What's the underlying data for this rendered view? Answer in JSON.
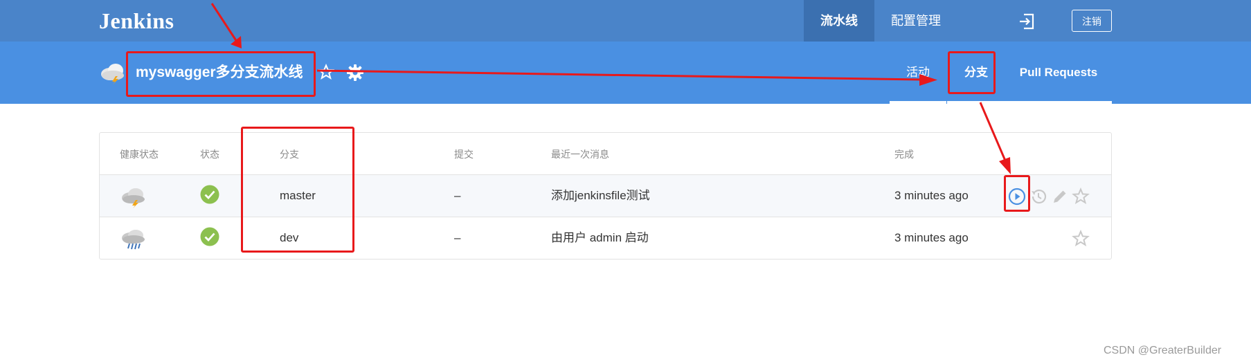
{
  "header": {
    "brand": "Jenkins",
    "nav": {
      "pipelines": "流水线",
      "admin": "配置管理"
    },
    "logout": "注销"
  },
  "pipeline": {
    "title": "myswagger多分支流水线",
    "tabs": {
      "activity": "活动",
      "branches": "分支",
      "pull_requests": "Pull Requests"
    }
  },
  "table": {
    "columns": {
      "health": "健康状态",
      "status": "状态",
      "branch": "分支",
      "commit": "提交",
      "message": "最近一次消息",
      "completed": "完成"
    },
    "rows": [
      {
        "health_icon": "stormy-weather-icon",
        "status_icon": "success-check-icon",
        "branch": "master",
        "commit": "–",
        "message": "添加jenkinsfile测试",
        "completed": "3 minutes ago"
      },
      {
        "health_icon": "rainy-weather-icon",
        "status_icon": "success-check-icon",
        "branch": "dev",
        "commit": "–",
        "message": "由用户 admin 启动",
        "completed": "3 minutes ago"
      }
    ]
  },
  "watermark": "CSDN @GreaterBuilder",
  "colors": {
    "top_bar": "#4a84c9",
    "sub_bar": "#4a90e2",
    "active_nav": "#3b70b0",
    "success": "#8cc04f",
    "run_icon": "#4a90e2",
    "annotation": "#e8191b"
  }
}
